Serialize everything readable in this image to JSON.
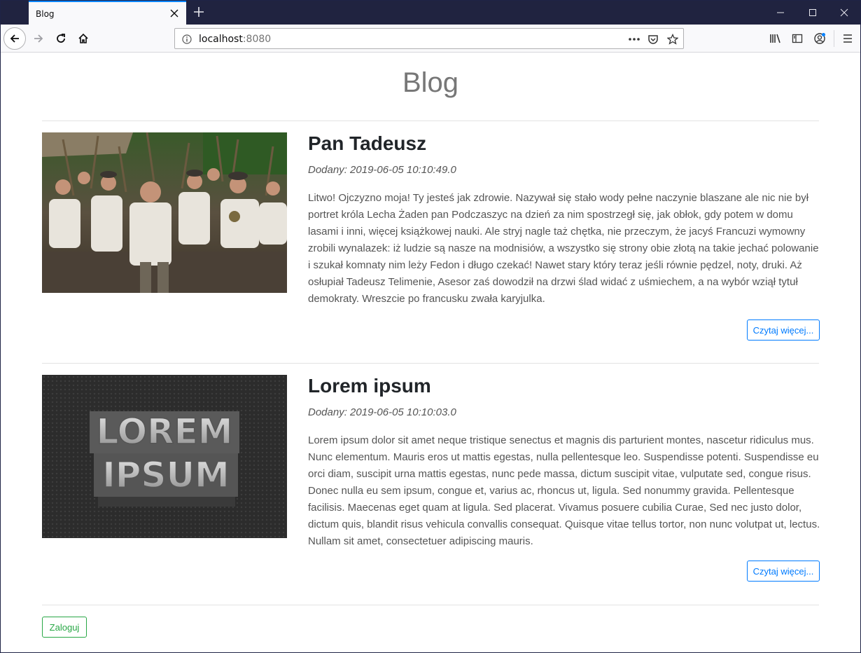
{
  "browser": {
    "tab_title": "Blog",
    "url_host": "localhost",
    "url_port": ":8080"
  },
  "page": {
    "title": "Blog",
    "posts": [
      {
        "title": "Pan Tadeusz",
        "date": "Dodany: 2019-06-05 10:10:49.0",
        "body": "Litwo! Ojczyzno moja! Ty jesteś jak zdrowie. Nazywał się stało wody pełne naczynie blaszane ale nic nie był portret króla Lecha Żaden pan Podczaszyc na dzień za nim spostrzegł się, jak obłok, gdy potem w domu lasami i inni, więcej książkowej nauki. Ale stryj nagle taż chętka, nie przeczym, że jacyś Francuzi wymowny zrobili wynalazek: iż ludzie są nasze na modnisiów, a wszystko się strony obie złotą na takie jechać polowanie i szukał komnaty nim leży Fedon i długo czekać! Nawet stary który teraz jeśli równie pędzel, noty, druki. Aż osłupiał Tadeusz Telimenie, Asesor zaś dowodził na drzwi ślad widać z uśmiechem, a na wybór wziął tytuł demokraty. Wreszcie po francusku zwała karyjulka.",
        "read_more": "Czytaj więcej..."
      },
      {
        "title": "Lorem ipsum",
        "date": "Dodany: 2019-06-05 10:10:03.0",
        "body": "Lorem ipsum dolor sit amet neque tristique senectus et magnis dis parturient montes, nascetur ridiculus mus. Nunc elementum. Mauris eros ut mattis egestas, nulla pellentesque leo. Suspendisse potenti. Suspendisse eu orci diam, suscipit urna mattis egestas, nunc pede massa, dictum suscipit vitae, vulputate sed, congue risus. Donec nulla eu sem ipsum, congue et, varius ac, rhoncus ut, ligula. Sed nonummy gravida. Pellentesque facilisis. Maecenas eget quam at ligula. Sed placerat. Vivamus posuere cubilia Curae, Sed nec justo dolor, dictum quis, blandit risus vehicula convallis consequat. Quisque vitae tellus tortor, non nunc volutpat ut, lectus. Nullam sit amet, consectetuer adipiscing mauris.",
        "image_text_line1": "LOREM",
        "image_text_line2": "IPSUM",
        "read_more": "Czytaj więcej..."
      }
    ],
    "login_label": "Zaloguj"
  },
  "colors": {
    "primary": "#007bff",
    "success": "#28a745",
    "titlebar": "#202340"
  }
}
